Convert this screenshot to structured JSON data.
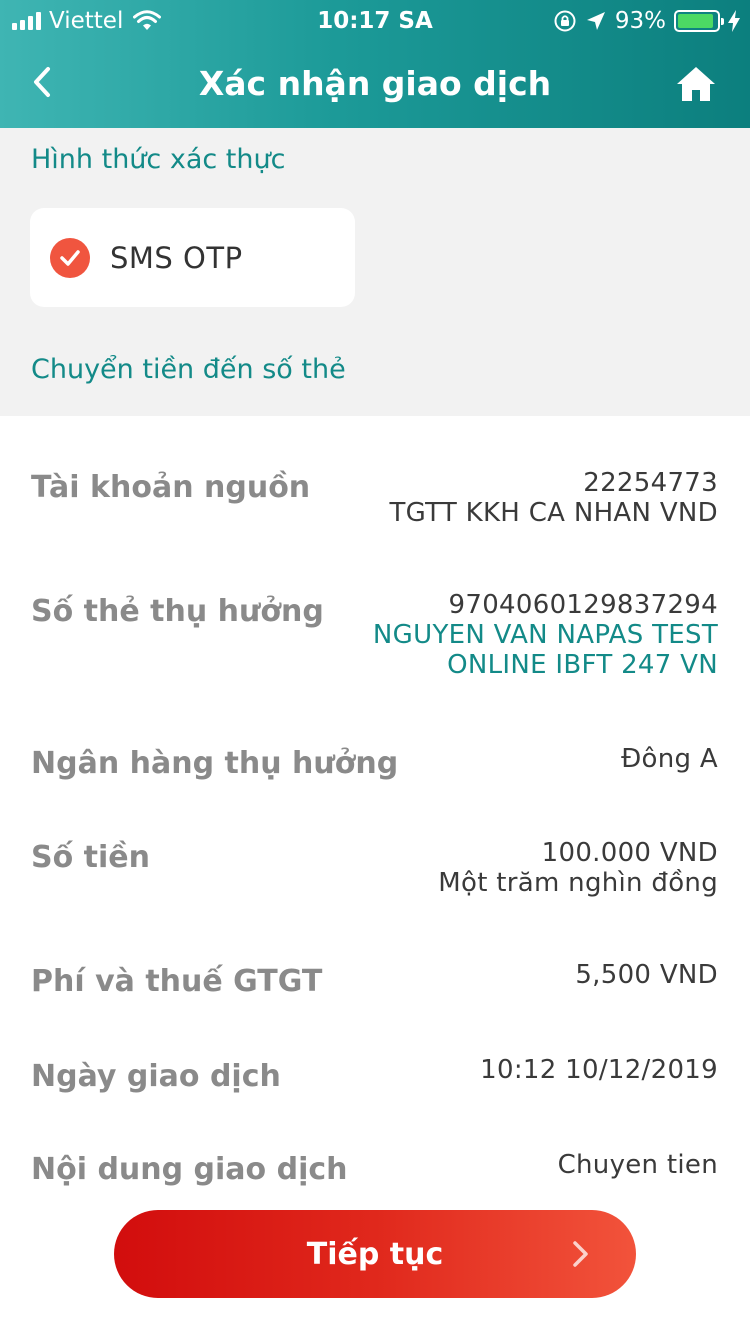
{
  "status_bar": {
    "carrier": "Viettel",
    "time": "10:17 SA",
    "battery_percent": "93%",
    "battery_level": 0.93
  },
  "header": {
    "title": "Xác nhận giao dịch",
    "back_icon": "chevron-left-icon",
    "home_icon": "home-icon"
  },
  "auth": {
    "section_label": "Hình thức xác thực",
    "method_label": "SMS OTP",
    "method_selected": true
  },
  "transfer_type": "Chuyển tiền đến số thẻ",
  "details": {
    "source_account": {
      "label": "Tài khoản nguồn",
      "number": "22254773",
      "name": "TGTT KKH CA NHAN VND"
    },
    "beneficiary_card": {
      "label": "Số thẻ thụ hưởng",
      "number": "9704060129837294",
      "name_line1": "NGUYEN VAN NAPAS TEST",
      "name_line2": "ONLINE IBFT 247 VN"
    },
    "beneficiary_bank": {
      "label": "Ngân hàng thụ hưởng",
      "value": "Đông A"
    },
    "amount": {
      "label": "Số tiền",
      "value": "100.000 VND",
      "in_words": "Một trăm nghìn đồng"
    },
    "fee": {
      "label": "Phí và thuế GTGT",
      "value": "5,500 VND"
    },
    "date": {
      "label": "Ngày giao dịch",
      "value": "10:12 10/12/2019"
    },
    "content": {
      "label": "Nội dung giao dịch",
      "value": "Chuyen tien"
    }
  },
  "continue_button": {
    "label": "Tiếp tục"
  },
  "colors": {
    "teal": "#138a88",
    "accent_red": "#e0281c",
    "check_orange": "#f0553f",
    "battery_green": "#4cd964"
  }
}
